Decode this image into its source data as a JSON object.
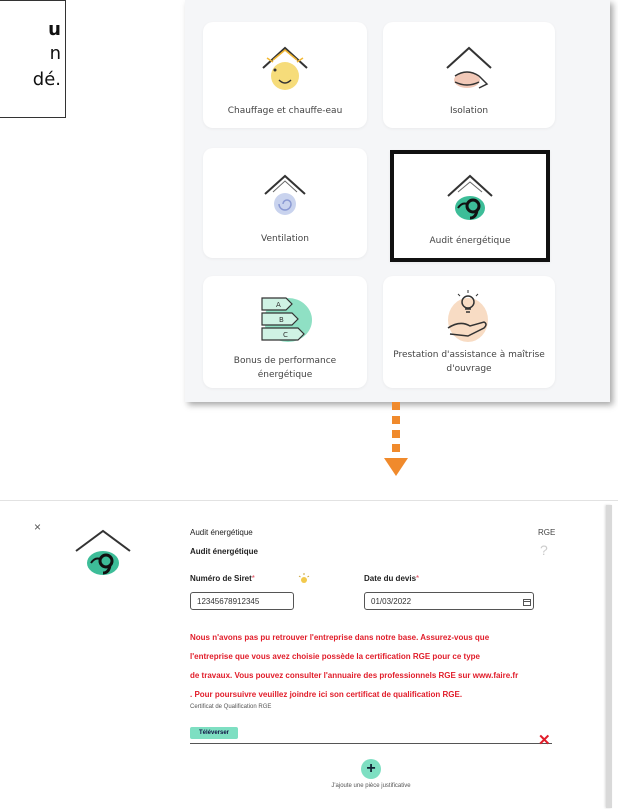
{
  "crop_text": {
    "line1": "u",
    "line2": "n",
    "line3": "dé."
  },
  "categories": [
    {
      "label": "Chauffage et chauffe-eau",
      "icon": "heating-icon",
      "selected": false
    },
    {
      "label": "Isolation",
      "icon": "insulation-icon",
      "selected": false
    },
    {
      "label": "Ventilation",
      "icon": "ventilation-icon",
      "selected": false
    },
    {
      "label": "Audit énergétique",
      "icon": "energy-audit-icon",
      "selected": true
    },
    {
      "label": "Bonus de performance énergétique",
      "icon": "energy-rating-icon",
      "selected": false
    },
    {
      "label": "Prestation d'assistance à maîtrise d'ouvrage",
      "icon": "assistance-icon",
      "selected": false
    }
  ],
  "form": {
    "close_symbol": "×",
    "title": "Audit énergétique",
    "subtitle": "Audit énergétique",
    "rge_label": "RGE",
    "help_symbol": "?",
    "siret_label": "Numéro de Siret",
    "required_mark": "*",
    "siret_value": "12345678912345",
    "date_label": "Date du devis",
    "date_value": "01/03/2022",
    "warning_lines": [
      "Nous n'avons pas  pu retrouver l'entreprise  dans notre base.  Assurez-vous que",
      "l'entreprise que vous  avez choisie possède  la certification  RGE pour ce type",
      "de travaux. Vous  pouvez consulter  l'annuaire des  professionnels RGE sur www.faire.fr",
      ". Pour poursuivre  veuillez joindre ici son  certificat de qualification RGE."
    ],
    "cert_label": "Certificat de Qualification RGE",
    "upload_label": "Téléverser",
    "delete_symbol": "✕",
    "add_symbol": "+",
    "add_label": "J'ajoute une pièce justificative"
  },
  "colors": {
    "accent": "#7edfc2",
    "warning": "#e11d2a",
    "arrow": "#f08a2c"
  }
}
